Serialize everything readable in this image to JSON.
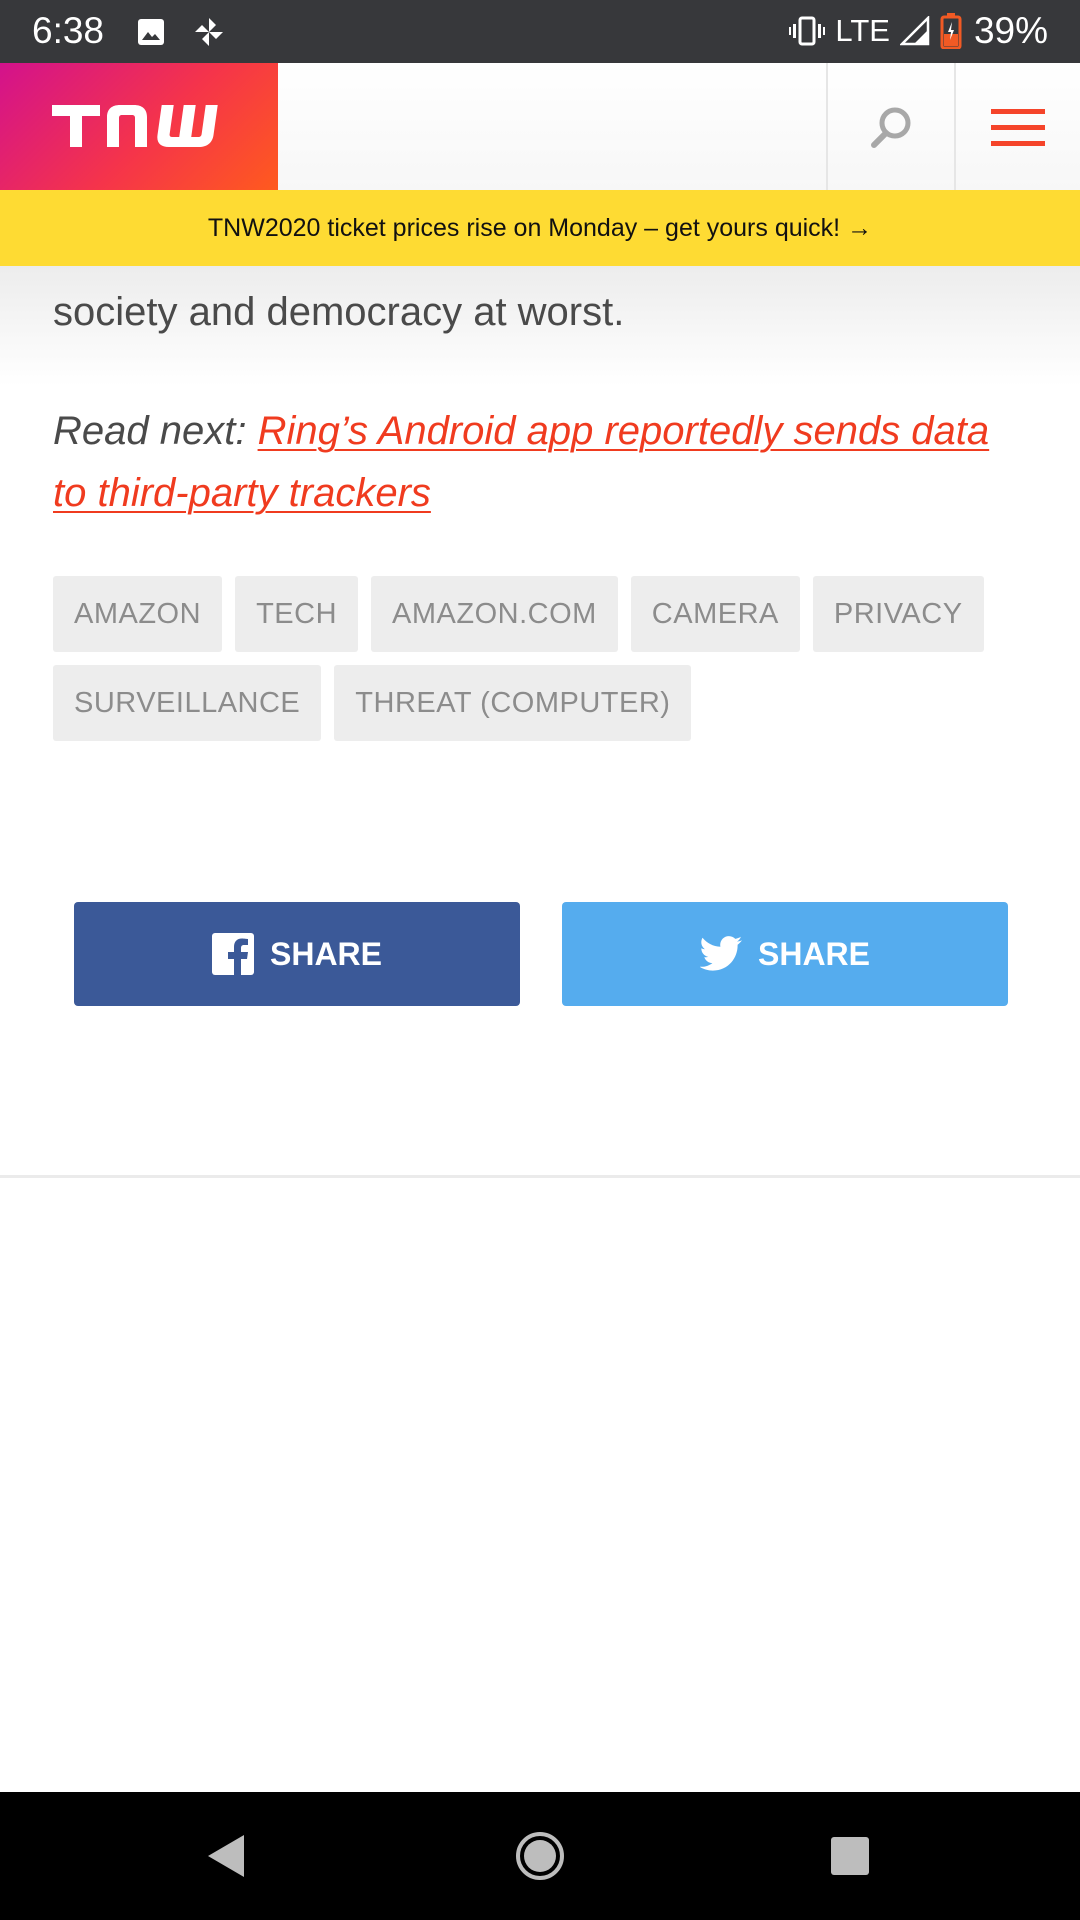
{
  "status_bar": {
    "time": "6:38",
    "network": "LTE",
    "battery_percent": "39%",
    "icons": [
      "image-icon",
      "pinwheel-icon",
      "vibrate-icon",
      "signal-icon",
      "battery-icon"
    ]
  },
  "header": {
    "logo_text": "TNW",
    "actions": [
      "search-icon",
      "menu-icon"
    ],
    "accent_color": "#f5442a"
  },
  "promo": {
    "text": "TNW2020 ticket prices rise on Monday – get yours quick! →",
    "background": "#fedb33"
  },
  "article": {
    "closing_text": "society and democracy at worst.",
    "read_next_label": "Read next: ",
    "read_next_link_line1": "Ring’s Android app reportedly sends data",
    "read_next_link_line2": "to third-party trackers",
    "link_color": "#f03b1f"
  },
  "tags": [
    "AMAZON",
    "TECH",
    "AMAZON.COM",
    "CAMERA",
    "PRIVACY",
    "SURVEILLANCE",
    "THREAT (COMPUTER)"
  ],
  "share": {
    "facebook_label": "SHARE",
    "twitter_label": "SHARE",
    "facebook_color": "#3b5998",
    "twitter_color": "#55acee"
  },
  "nav_bar": {
    "buttons": [
      "back-icon",
      "home-icon",
      "recents-icon"
    ]
  }
}
